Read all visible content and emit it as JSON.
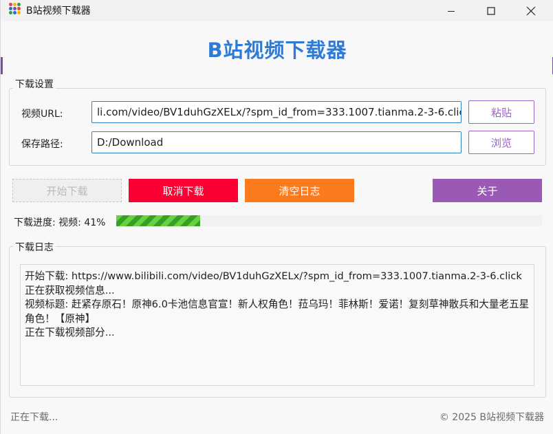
{
  "window": {
    "title": "B站视频下载器"
  },
  "header": {
    "title": "B站视频下载器"
  },
  "settings": {
    "group_label": "下载设置",
    "url_label": "视频URL:",
    "url_value": "li.com/video/BV1duhGzXELx/?spm_id_from=333.1007.tianma.2-3-6.click",
    "paste_label": "粘贴",
    "path_label": "保存路径:",
    "path_value": "D:/Download",
    "browse_label": "浏览"
  },
  "actions": {
    "start_label": "开始下载",
    "cancel_label": "取消下载",
    "clear_label": "清空日志",
    "about_label": "关于"
  },
  "progress": {
    "label": "下载进度: 视频: 41%",
    "percent": 41
  },
  "log": {
    "group_label": "下载日志",
    "lines": [
      "开始下载: https://www.bilibili.com/video/BV1duhGzXELx/?spm_id_from=333.1007.tianma.2-3-6.click",
      "正在获取视频信息...",
      "视频标题: 赶紧存原石！原神6.0卡池信息官宣！新人权角色！菈乌玛！菲林斯！爱诺！复刻草神散兵和大量老五星角色！【原神】",
      "正在下载视频部分..."
    ]
  },
  "status": {
    "left": "正在下载...",
    "right": "© 2025 B站视频下载器"
  },
  "colors": {
    "accent_purple": "#9b59b6",
    "title_blue": "#2e7bd6",
    "cancel_red": "#fc0033",
    "clear_orange": "#fc7a1e",
    "progress_green": "#4cbb2f"
  }
}
